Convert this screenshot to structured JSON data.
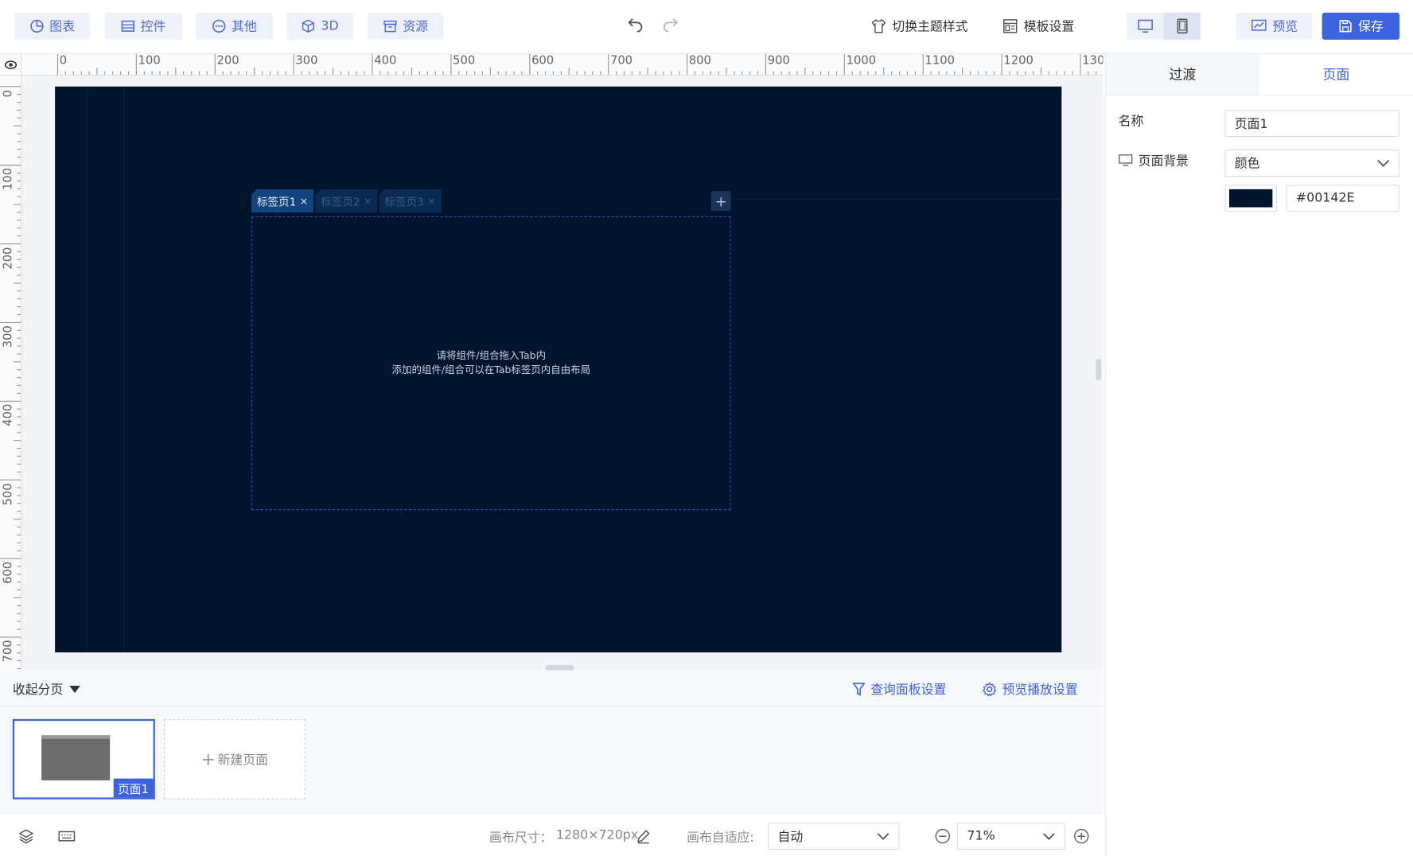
{
  "toolbar": {
    "chart": "图表",
    "widget": "控件",
    "other": "其他",
    "three_d": "3D",
    "resource": "资源",
    "switch_theme": "切换主题样式",
    "template_settings": "模板设置",
    "preview": "预览",
    "save": "保存"
  },
  "ruler": {
    "h_labels": [
      "0",
      "100",
      "200",
      "300",
      "400",
      "500",
      "600",
      "700",
      "800",
      "900",
      "1000",
      "1100",
      "1200",
      "130"
    ],
    "v_labels": [
      "0",
      "100",
      "200",
      "300",
      "400",
      "500",
      "600",
      "700"
    ]
  },
  "canvas": {
    "background": "#00142E",
    "tabs": [
      {
        "label": "标签页1",
        "active": true
      },
      {
        "label": "标签页2",
        "active": false
      },
      {
        "label": "标签页3",
        "active": false
      }
    ],
    "tab_add": "+",
    "tab_close": "×",
    "hint_line1": "请将组件/组合拖入Tab内",
    "hint_line2": "添加的组件/组合可以在Tab标签页内自由布局"
  },
  "right_panel": {
    "tabs": [
      {
        "label": "过渡",
        "active": false
      },
      {
        "label": "页面",
        "active": true
      }
    ],
    "name_label": "名称",
    "name_value": "页面1",
    "bg_label": "页面背景",
    "bg_type": "颜色",
    "bg_color": "#00142E"
  },
  "pages": {
    "collapse": "收起分页",
    "query_panel": "查询面板设置",
    "preview_play": "预览播放设置",
    "current_page": "页面1",
    "new_page": "新建页面"
  },
  "status": {
    "canvas_size_label": "画布尺寸：",
    "canvas_size_value": "1280×720px",
    "adapt_label": "画布自适应:",
    "adapt_value": "自动",
    "zoom_value": "71%"
  }
}
